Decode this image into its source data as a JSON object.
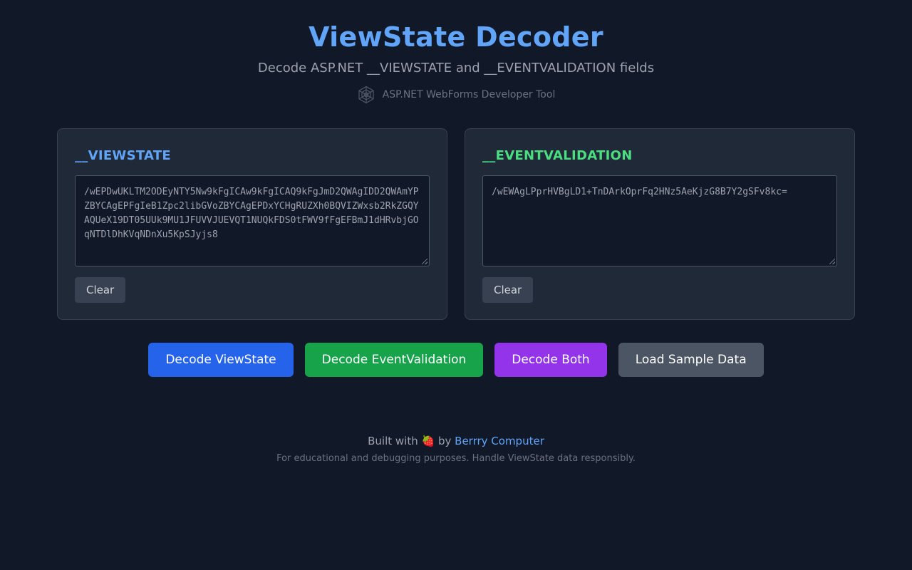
{
  "header": {
    "title": "ViewState Decoder",
    "subtitle": "Decode ASP.NET __VIEWSTATE and __EVENTVALIDATION fields",
    "tagline": "ASP.NET WebForms Developer Tool",
    "tagline_icon": "spider-web-icon"
  },
  "viewstate_panel": {
    "title": "__VIEWSTATE",
    "value": "/wEPDwUKLTM2ODEyNTY5Nw9kFgICAw9kFgICAQ9kFgJmD2QWAgIDD2QWAmYPZBYCAgEPFgIeB1Zpc2libGVoZBYCAgEPDxYCHgRUZXh0BQVIZWxsb2RkZGQYAQUeX19DT05UUk9MU1JFUVVJUEVQT1NUQkFDS0tFWV9fFgEFBmJ1dHRvbjGOqNTDlDhKVqNDnXu5KpSJyjs8",
    "clear_label": "Clear",
    "accent": "#60a5fa"
  },
  "eventvalidation_panel": {
    "title": "__EVENTVALIDATION",
    "value": "/wEWAgLPprHVBgLD1+TnDArkOprFq2HNz5AeKjzG8B7Y2gSFv8kc=",
    "clear_label": "Clear",
    "accent": "#4ade80"
  },
  "actions": {
    "decode_viewstate": {
      "label": "Decode ViewState",
      "color": "#2563eb"
    },
    "decode_eventvalidation": {
      "label": "Decode EventValidation",
      "color": "#16a34a"
    },
    "decode_both": {
      "label": "Decode Both",
      "color": "#9333ea"
    },
    "load_sample": {
      "label": "Load Sample Data",
      "color": "#4b5563"
    }
  },
  "footer": {
    "built_with": "Built with",
    "by": "by",
    "emoji": "🍓",
    "link_text": "Berrry Computer",
    "note": "For educational and debugging purposes. Handle ViewState data responsibly."
  }
}
